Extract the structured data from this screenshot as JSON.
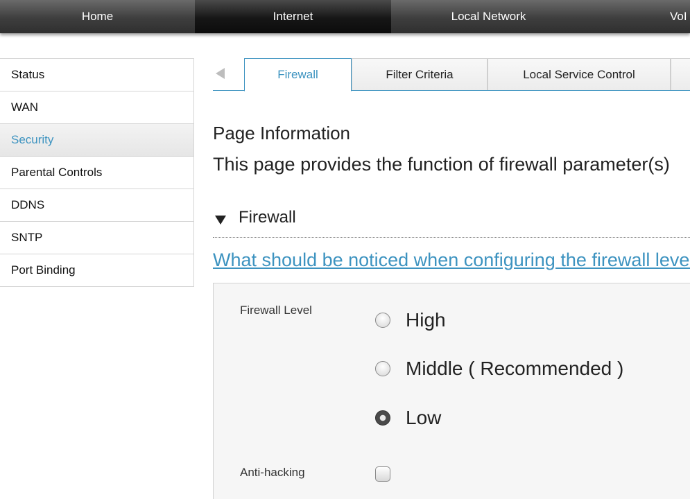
{
  "topnav": {
    "items": [
      {
        "label": "Home"
      },
      {
        "label": "Internet"
      },
      {
        "label": "Local Network"
      },
      {
        "label": "VoI"
      }
    ]
  },
  "sidebar": {
    "items": [
      {
        "label": "Status"
      },
      {
        "label": "WAN"
      },
      {
        "label": "Security"
      },
      {
        "label": "Parental Controls"
      },
      {
        "label": "DDNS"
      },
      {
        "label": "SNTP"
      },
      {
        "label": "Port Binding"
      }
    ],
    "active": "Security"
  },
  "tabs": {
    "items": [
      {
        "label": "Firewall"
      },
      {
        "label": "Filter Criteria"
      },
      {
        "label": "Local Service Control"
      }
    ],
    "active": "Firewall"
  },
  "page_info": {
    "title": "Page Information",
    "text": "This page provides the function of firewall parameter(s)"
  },
  "section": {
    "title": "Firewall"
  },
  "help_link": "What should be noticed when configuring the firewall level",
  "form": {
    "firewall_level": {
      "label": "Firewall Level",
      "options": [
        {
          "label": "High",
          "checked": false
        },
        {
          "label": "Middle ( Recommended )",
          "checked": false
        },
        {
          "label": "Low",
          "checked": true
        }
      ]
    },
    "anti_hacking": {
      "label": "Anti-hacking",
      "checked": false
    }
  },
  "colors": {
    "accent": "#3d93c0",
    "nav_bg": "#3e3e3e",
    "panel_bg": "#f6f6f6"
  }
}
